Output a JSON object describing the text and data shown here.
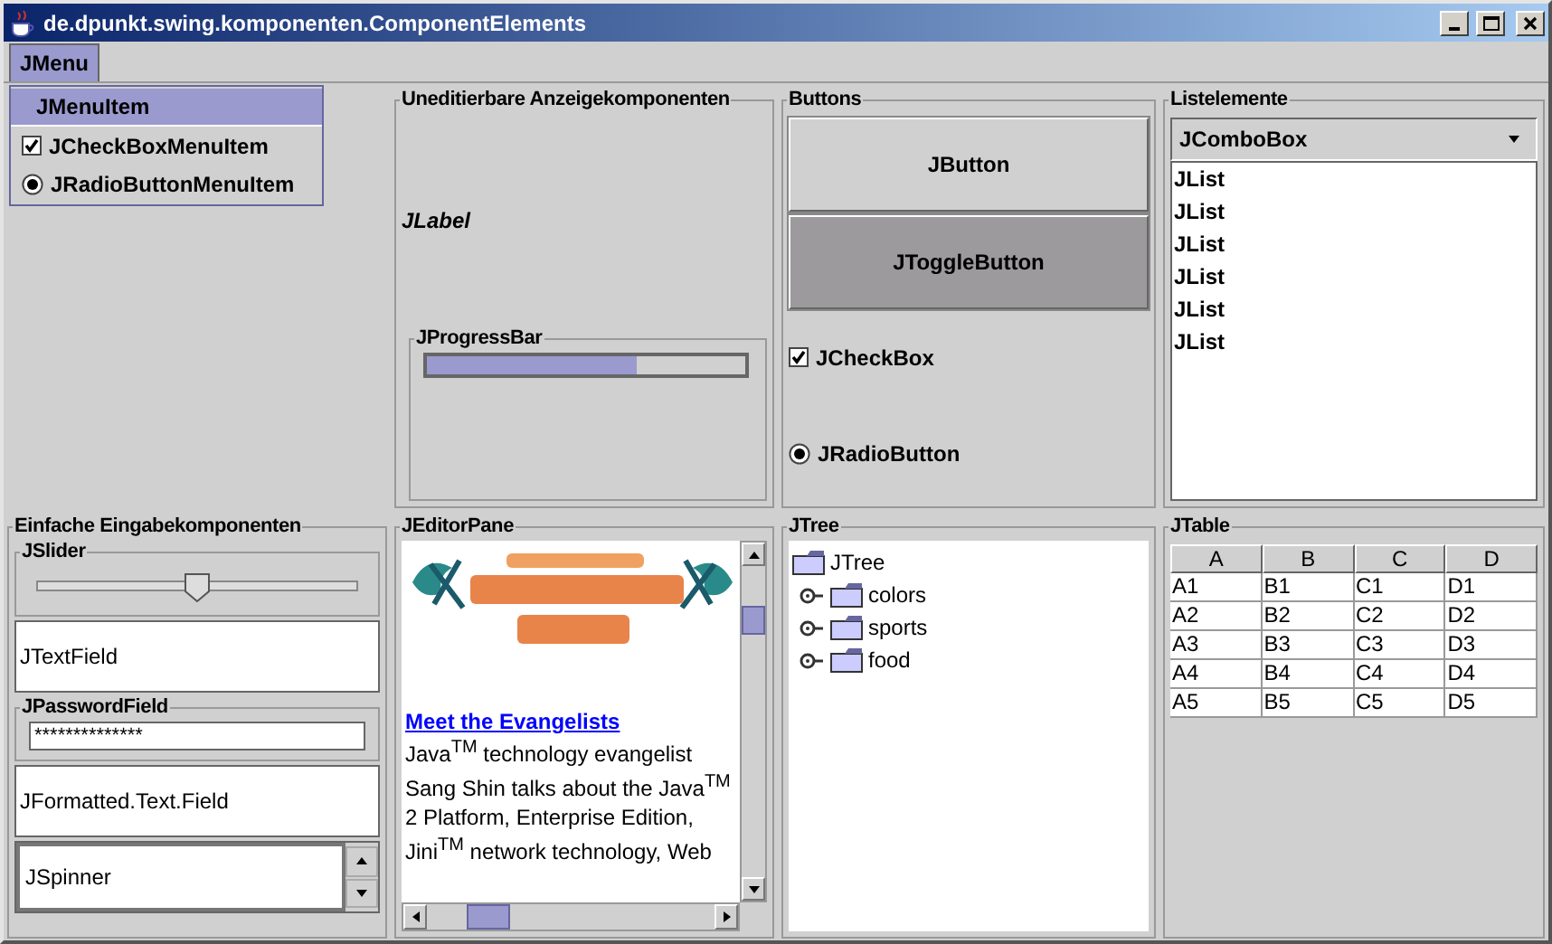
{
  "window": {
    "title": "de.dpunkt.swing.komponenten.ComponentElements"
  },
  "menu": {
    "label": "JMenu",
    "selected": true,
    "items": [
      {
        "kind": "item",
        "label": "JMenuItem",
        "selected": true
      },
      {
        "kind": "checkbox",
        "label": "JCheckBoxMenuItem",
        "checked": true
      },
      {
        "kind": "radio",
        "label": "JRadioButtonMenuItem",
        "checked": true
      }
    ]
  },
  "display": {
    "title": "Uneditierbare Anzeigekomponenten",
    "label": "JLabel",
    "progress": {
      "title": "JProgressBar",
      "level": 0.66
    }
  },
  "buttons": {
    "title": "Buttons",
    "button": "JButton",
    "toggle": {
      "label": "JToggleButton",
      "selected": true
    },
    "checkbox": {
      "label": "JCheckBox",
      "checked": true
    },
    "radio": {
      "label": "JRadioButton",
      "checked": true
    }
  },
  "lists": {
    "title": "Listelemente",
    "combo": "JComboBox",
    "items": [
      "JList",
      "JList",
      "JList",
      "JList",
      "JList",
      "JList"
    ]
  },
  "input": {
    "title": "Einfache Eingabekomponenten",
    "slider": {
      "title": "JSlider",
      "level": 0.5
    },
    "text_field": "JTextField",
    "password": {
      "title": "JPasswordField",
      "value": "**************"
    },
    "formatted": "JFormatted.Text.Field",
    "spinner": "JSpinner"
  },
  "editor": {
    "title": "JEditorPane",
    "link": "Meet the Evangelists",
    "paragraph": "Java$^{TM}$ technology evangelist Sang Shin talks about the Java$^{TM}$ 2 Platform, Enterprise Edition, Jini$^{TM}$ network technology, Web"
  },
  "tree": {
    "title": "JTree",
    "root": "JTree",
    "children": [
      {
        "label": "colors",
        "expanded": false
      },
      {
        "label": "sports",
        "expanded": false
      },
      {
        "label": "food",
        "expanded": false
      }
    ]
  },
  "table": {
    "title": "JTable",
    "columns": [
      "A",
      "B",
      "C",
      "D"
    ],
    "rows": [
      [
        "A1",
        "B1",
        "C1",
        "D1"
      ],
      [
        "A2",
        "B2",
        "C2",
        "D2"
      ],
      [
        "A3",
        "B3",
        "C3",
        "D3"
      ],
      [
        "A4",
        "B4",
        "C4",
        "D4"
      ],
      [
        "A5",
        "B5",
        "C5",
        "D5"
      ]
    ]
  }
}
